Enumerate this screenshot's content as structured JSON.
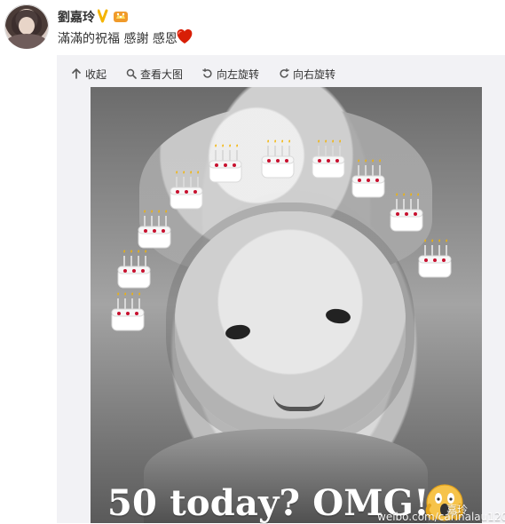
{
  "post": {
    "username": "劉嘉玲",
    "text": "滿滿的祝福 感謝 感恩",
    "toolbar": {
      "collapse": "收起",
      "view_large": "查看大图",
      "rotate_left": "向左旋转",
      "rotate_right": "向右旋转"
    }
  },
  "image": {
    "caption": "50 today? OMG!!",
    "watermark": "weibo.com/carinalau1208",
    "watermark_suffix": "嘉玲"
  },
  "colors": {
    "heart": "#d81e06",
    "badge_v": "#f4b400"
  },
  "icons": {
    "verified": "verified-v-icon",
    "crown": "crown-badge-icon",
    "heart": "heart-icon",
    "collapse": "collapse-arrow-icon",
    "zoom": "magnifier-icon",
    "rotate_left": "rotate-left-icon",
    "rotate_right": "rotate-right-icon",
    "cake": "birthday-cake-icon",
    "scream": "screaming-face-icon"
  }
}
